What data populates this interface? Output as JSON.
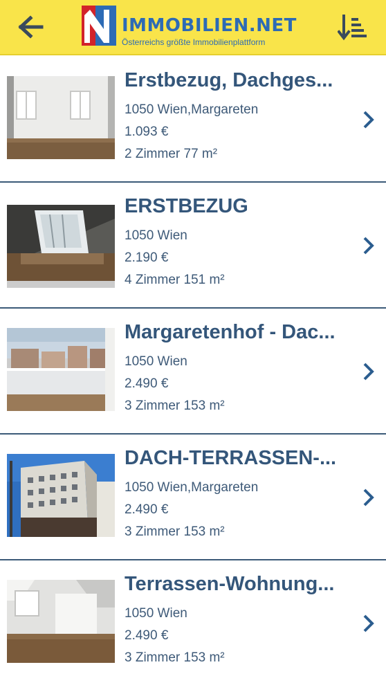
{
  "header": {
    "logo_title": "IMMOBILIEN.NET",
    "logo_tagline": "Österreichs größte Immobilienplattform",
    "back_icon": "arrow-left-icon",
    "sort_icon": "sort-descending-icon",
    "background_color": "#f9e44a",
    "brand_color": "#2d6bb5"
  },
  "listings": [
    {
      "title": "Erstbezug, Dachges...",
      "location": "1050 Wien,Margareten",
      "price": "1.093 €",
      "details": "2 Zimmer 77 m²"
    },
    {
      "title": "ERSTBEZUG",
      "location": "1050 Wien",
      "price": "2.190 €",
      "details": "4 Zimmer 151 m²"
    },
    {
      "title": "Margaretenhof - Dac...",
      "location": "1050 Wien",
      "price": "2.490 €",
      "details": "3 Zimmer 153 m²"
    },
    {
      "title": "DACH-TERRASSEN-...",
      "location": "1050 Wien,Margareten",
      "price": "2.490 €",
      "details": "3 Zimmer 153 m²"
    },
    {
      "title": "Terrassen-Wohnung...",
      "location": "1050 Wien",
      "price": "2.490 €",
      "details": "3 Zimmer 153 m²"
    }
  ],
  "colors": {
    "title_text": "#34567a",
    "body_text": "#3e5a78",
    "chevron": "#2b5d8f",
    "divider": "#3b5a78"
  }
}
